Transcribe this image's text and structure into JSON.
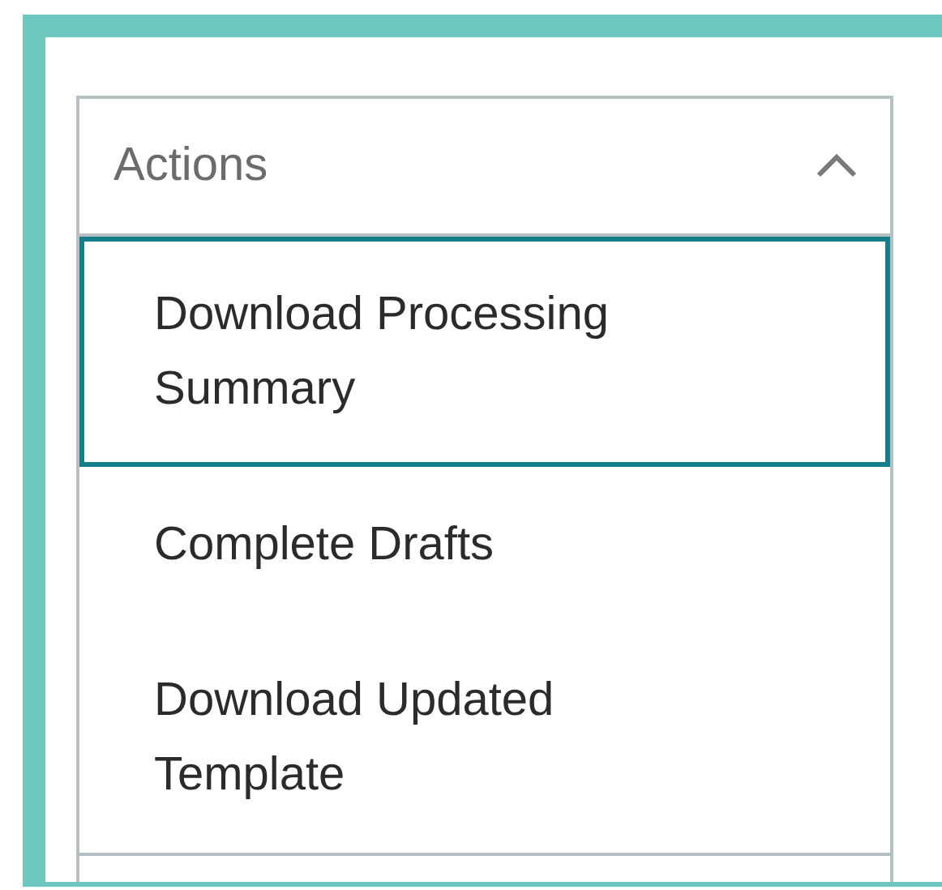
{
  "dropdown": {
    "label": "Actions",
    "expanded": true,
    "items": [
      {
        "label": "Download Processing Summary",
        "selected": true
      },
      {
        "label": "Complete Drafts",
        "selected": false
      },
      {
        "label": "Download Updated Template",
        "selected": false
      }
    ]
  }
}
